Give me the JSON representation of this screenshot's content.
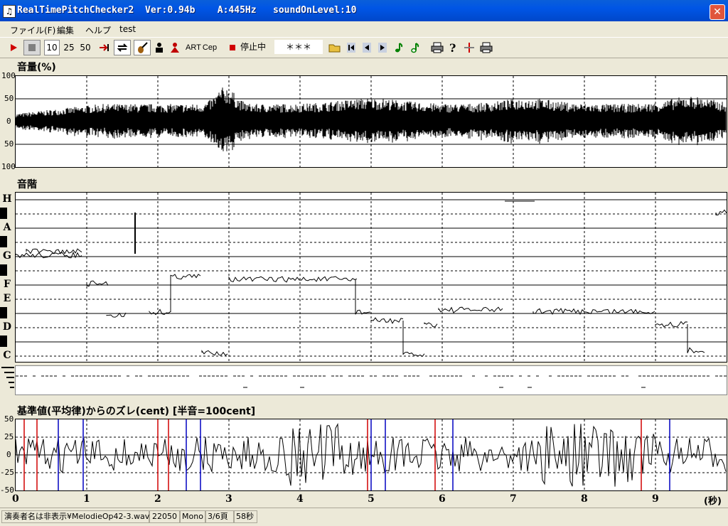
{
  "window": {
    "title": "RealTimePitchChecker2  Ver:0.94b    A:445Hz   soundOnLevel:10",
    "close": "✕",
    "icon": "♫"
  },
  "menu": [
    "ファイル(F)",
    "編集",
    "ヘルプ",
    "test"
  ],
  "toolbar": {
    "counts": [
      "10",
      "25",
      "50"
    ],
    "art": "ART",
    "cep": "Cep",
    "status": "停止中",
    "field": "＊＊＊"
  },
  "volume": {
    "title": "音量(%)",
    "ticks": [
      "100",
      "50",
      "0",
      "50",
      "100"
    ]
  },
  "scale": {
    "title": "音階",
    "notes": [
      "H",
      "A",
      "G",
      "F",
      "E",
      "D",
      "C"
    ]
  },
  "deviation": {
    "title": "基準値(平均律)からのズレ(cent) [半音=100cent]",
    "ticks": [
      "50",
      "25",
      "0",
      "-25",
      "-50"
    ]
  },
  "time": {
    "ticks": [
      "0",
      "1",
      "2",
      "3",
      "4",
      "5",
      "6",
      "7",
      "8",
      "9"
    ],
    "unit": "(秒)"
  },
  "status": {
    "file": "演奏者名は非表示¥MelodieOp42-3.wav",
    "rate": "22050",
    "channel": "Mono",
    "page": "3/6頁",
    "length": "58秒"
  },
  "colors": {
    "titlebar": "#0055e5",
    "accent_red": "#d00000",
    "accent_blue": "#0000c0"
  }
}
